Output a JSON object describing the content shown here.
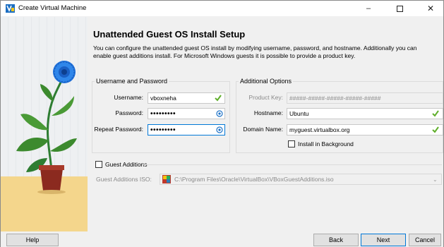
{
  "window": {
    "title": "Create Virtual Machine",
    "icon": "virtualbox-icon"
  },
  "header": {
    "title": "Unattended Guest OS Install Setup",
    "description": "You can configure the unattended guest OS install by modifying username, password, and hostname. Additionally you can enable guest additions install. For Microsoft Windows guests it is possible to provide a product key."
  },
  "credentials": {
    "group_title": "Username and Password",
    "username_label": "Username:",
    "username_value": "vboxneha",
    "password_label": "Password:",
    "password_value": "•••••••••",
    "repeat_password_label": "Repeat Password:",
    "repeat_password_value": "•••••••••"
  },
  "additional": {
    "group_title": "Additional Options",
    "product_key_label": "Product Key:",
    "product_key_value": "#####-#####-#####-#####-#####",
    "hostname_label": "Hostname:",
    "hostname_value": "Ubuntu",
    "domain_label": "Domain Name:",
    "domain_value": "myguest.virtualbox.org",
    "install_background_label": "Install in Background"
  },
  "guest_additions": {
    "label": "Guest Additions",
    "iso_label": "Guest Additions ISO:",
    "iso_value": "C:\\Program Files\\Oracle\\VirtualBox\\VBoxGuestAdditions.iso"
  },
  "buttons": {
    "help": "Help",
    "back": "Back",
    "next": "Next",
    "cancel": "Cancel"
  },
  "colors": {
    "accent": "#0078d7",
    "valid_check": "#5fae2a",
    "eye_icon": "#1e73c8"
  }
}
